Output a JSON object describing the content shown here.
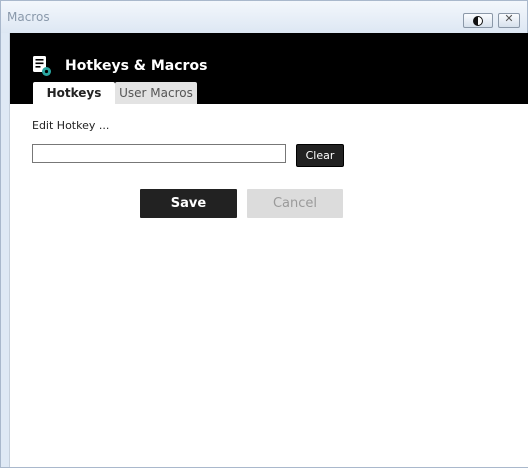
{
  "window": {
    "title": "Macros",
    "close_glyph": "✕"
  },
  "header": {
    "title": "Hotkeys & Macros",
    "icon": "macro-document-icon"
  },
  "tabs": [
    {
      "label": "Hotkeys",
      "active": true
    },
    {
      "label": "User Macros",
      "active": false
    }
  ],
  "editor": {
    "label": "Edit Hotkey ...",
    "input_value": "",
    "clear_label": "Clear"
  },
  "actions": {
    "save_label": "Save",
    "cancel_label": "Cancel"
  },
  "colors": {
    "header_bg": "#000000",
    "primary_button": "#222222",
    "disabled_button": "#dcdcdc",
    "accent_icon": "#2aa5a0"
  }
}
